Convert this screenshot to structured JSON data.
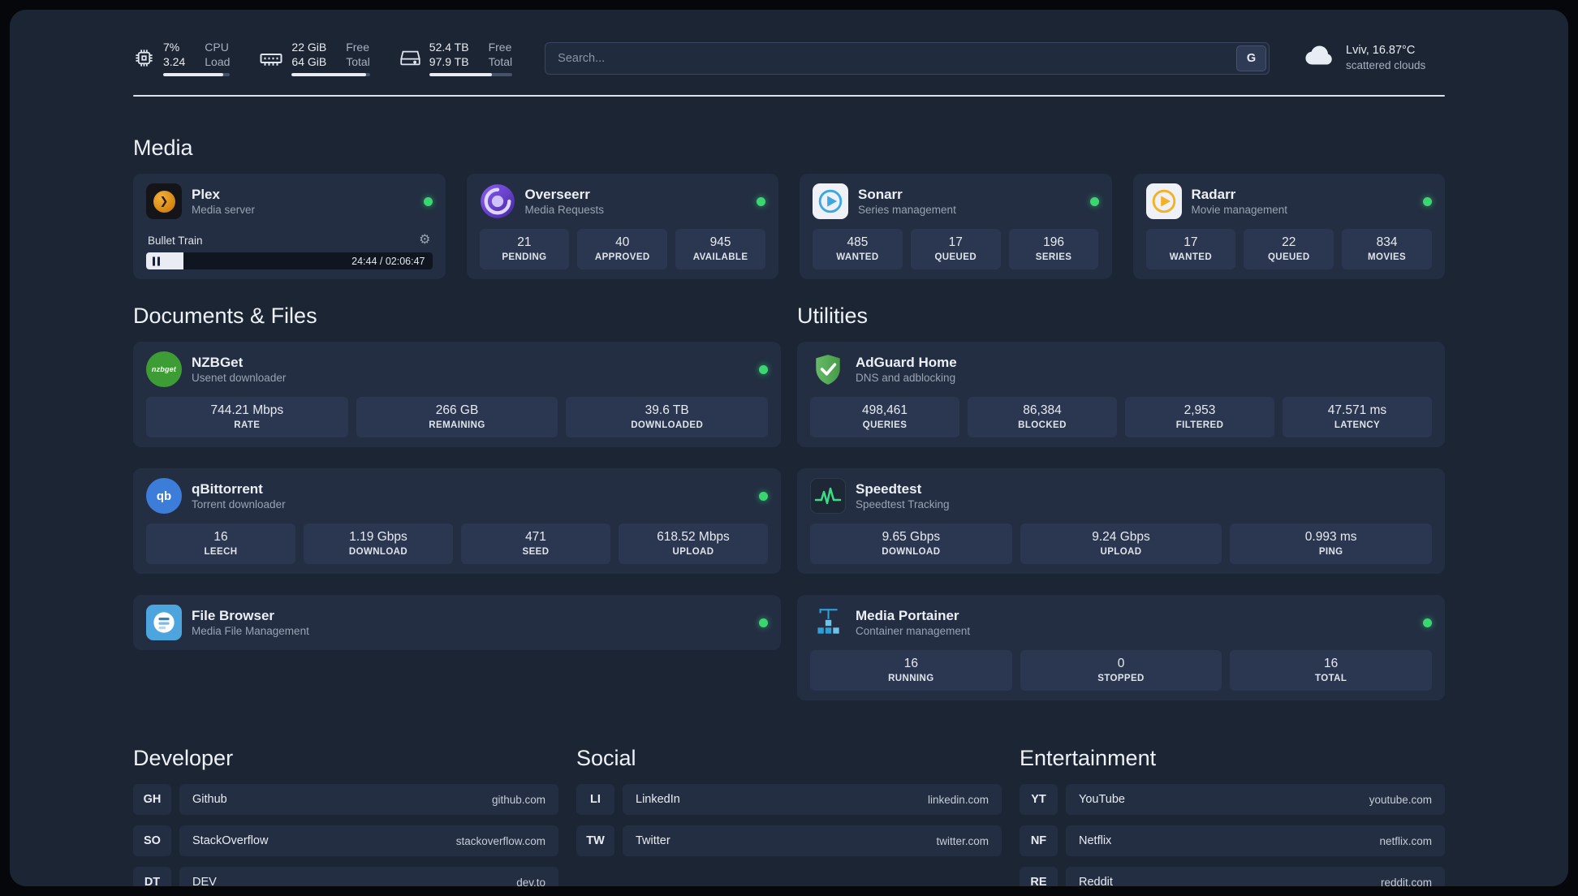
{
  "topbar": {
    "cpu": {
      "value1": "7%",
      "label1": "CPU",
      "value2": "3.24",
      "label2": "Load",
      "progress": 90
    },
    "ram": {
      "value1": "22 GiB",
      "label1": "Free",
      "value2": "64 GiB",
      "label2": "Total",
      "progress": 95
    },
    "disk": {
      "value1": "52.4 TB",
      "label1": "Free",
      "value2": "97.9 TB",
      "label2": "Total",
      "progress": 75
    },
    "search": {
      "placeholder": "Search...",
      "engine_button": "G"
    },
    "weather": {
      "location": "Lviv, 16.87°C",
      "condition": "scattered clouds"
    }
  },
  "media": {
    "title": "Media",
    "plex": {
      "name": "Plex",
      "subtitle": "Media server",
      "online": true,
      "player": {
        "track": "Bullet Train",
        "time": "24:44 / 02:06:47",
        "progress": 13
      }
    },
    "apps": [
      {
        "name": "Overseerr",
        "subtitle": "Media Requests",
        "icon": "overseerr",
        "online": true,
        "stats": [
          {
            "value": "21",
            "label": "PENDING"
          },
          {
            "value": "40",
            "label": "APPROVED"
          },
          {
            "value": "945",
            "label": "AVAILABLE"
          }
        ]
      },
      {
        "name": "Sonarr",
        "subtitle": "Series management",
        "icon": "sonarr",
        "online": true,
        "stats": [
          {
            "value": "485",
            "label": "WANTED"
          },
          {
            "value": "17",
            "label": "QUEUED"
          },
          {
            "value": "196",
            "label": "SERIES"
          }
        ]
      },
      {
        "name": "Radarr",
        "subtitle": "Movie management",
        "icon": "radarr",
        "online": true,
        "stats": [
          {
            "value": "17",
            "label": "WANTED"
          },
          {
            "value": "22",
            "label": "QUEUED"
          },
          {
            "value": "834",
            "label": "MOVIES"
          }
        ]
      }
    ]
  },
  "documents": {
    "title": "Documents & Files",
    "apps": [
      {
        "name": "NZBGet",
        "subtitle": "Usenet downloader",
        "icon": "nzbget",
        "online": true,
        "stats": [
          {
            "value": "744.21 Mbps",
            "label": "RATE"
          },
          {
            "value": "266 GB",
            "label": "REMAINING"
          },
          {
            "value": "39.6 TB",
            "label": "DOWNLOADED"
          }
        ]
      },
      {
        "name": "qBittorrent",
        "subtitle": "Torrent downloader",
        "icon": "qbittorrent",
        "online": true,
        "stats": [
          {
            "value": "16",
            "label": "LEECH"
          },
          {
            "value": "1.19 Gbps",
            "label": "DOWNLOAD"
          },
          {
            "value": "471",
            "label": "SEED"
          },
          {
            "value": "618.52 Mbps",
            "label": "UPLOAD"
          }
        ]
      },
      {
        "name": "File Browser",
        "subtitle": "Media File Management",
        "icon": "filebrowser",
        "online": true,
        "stats": []
      }
    ]
  },
  "utilities": {
    "title": "Utilities",
    "apps": [
      {
        "name": "AdGuard Home",
        "subtitle": "DNS and adblocking",
        "icon": "adguard",
        "online": false,
        "stats": [
          {
            "value": "498,461",
            "label": "QUERIES"
          },
          {
            "value": "86,384",
            "label": "BLOCKED"
          },
          {
            "value": "2,953",
            "label": "FILTERED"
          },
          {
            "value": "47.571 ms",
            "label": "LATENCY"
          }
        ]
      },
      {
        "name": "Speedtest",
        "subtitle": "Speedtest Tracking",
        "icon": "speedtest",
        "online": false,
        "stats": [
          {
            "value": "9.65 Gbps",
            "label": "DOWNLOAD"
          },
          {
            "value": "9.24 Gbps",
            "label": "UPLOAD"
          },
          {
            "value": "0.993 ms",
            "label": "PING"
          }
        ]
      },
      {
        "name": "Media Portainer",
        "subtitle": "Container management",
        "icon": "portainer",
        "online": true,
        "stats": [
          {
            "value": "16",
            "label": "RUNNING"
          },
          {
            "value": "0",
            "label": "STOPPED"
          },
          {
            "value": "16",
            "label": "TOTAL"
          }
        ]
      }
    ]
  },
  "links": [
    {
      "title": "Developer",
      "items": [
        {
          "abbr": "GH",
          "name": "Github",
          "url": "github.com"
        },
        {
          "abbr": "SO",
          "name": "StackOverflow",
          "url": "stackoverflow.com"
        },
        {
          "abbr": "DT",
          "name": "DEV",
          "url": "dev.to"
        }
      ]
    },
    {
      "title": "Social",
      "items": [
        {
          "abbr": "LI",
          "name": "LinkedIn",
          "url": "linkedin.com"
        },
        {
          "abbr": "TW",
          "name": "Twitter",
          "url": "twitter.com"
        }
      ]
    },
    {
      "title": "Entertainment",
      "items": [
        {
          "abbr": "YT",
          "name": "YouTube",
          "url": "youtube.com"
        },
        {
          "abbr": "NF",
          "name": "Netflix",
          "url": "netflix.com"
        },
        {
          "abbr": "RE",
          "name": "Reddit",
          "url": "reddit.com"
        }
      ]
    }
  ],
  "colors": {
    "background": "#1b2534",
    "card": "#232e42",
    "stat_box": "#2b3750",
    "status_online": "#3bd671",
    "plex_accent": "#e5a00d",
    "overseerr_accent": "#6d45d8",
    "sonarr_accent": "#3ca7e0",
    "radarr_accent": "#f6b024",
    "adguard_accent": "#55ad55",
    "speedtest_accent": "#3ddc84",
    "portainer_accent": "#2f9fd8"
  }
}
